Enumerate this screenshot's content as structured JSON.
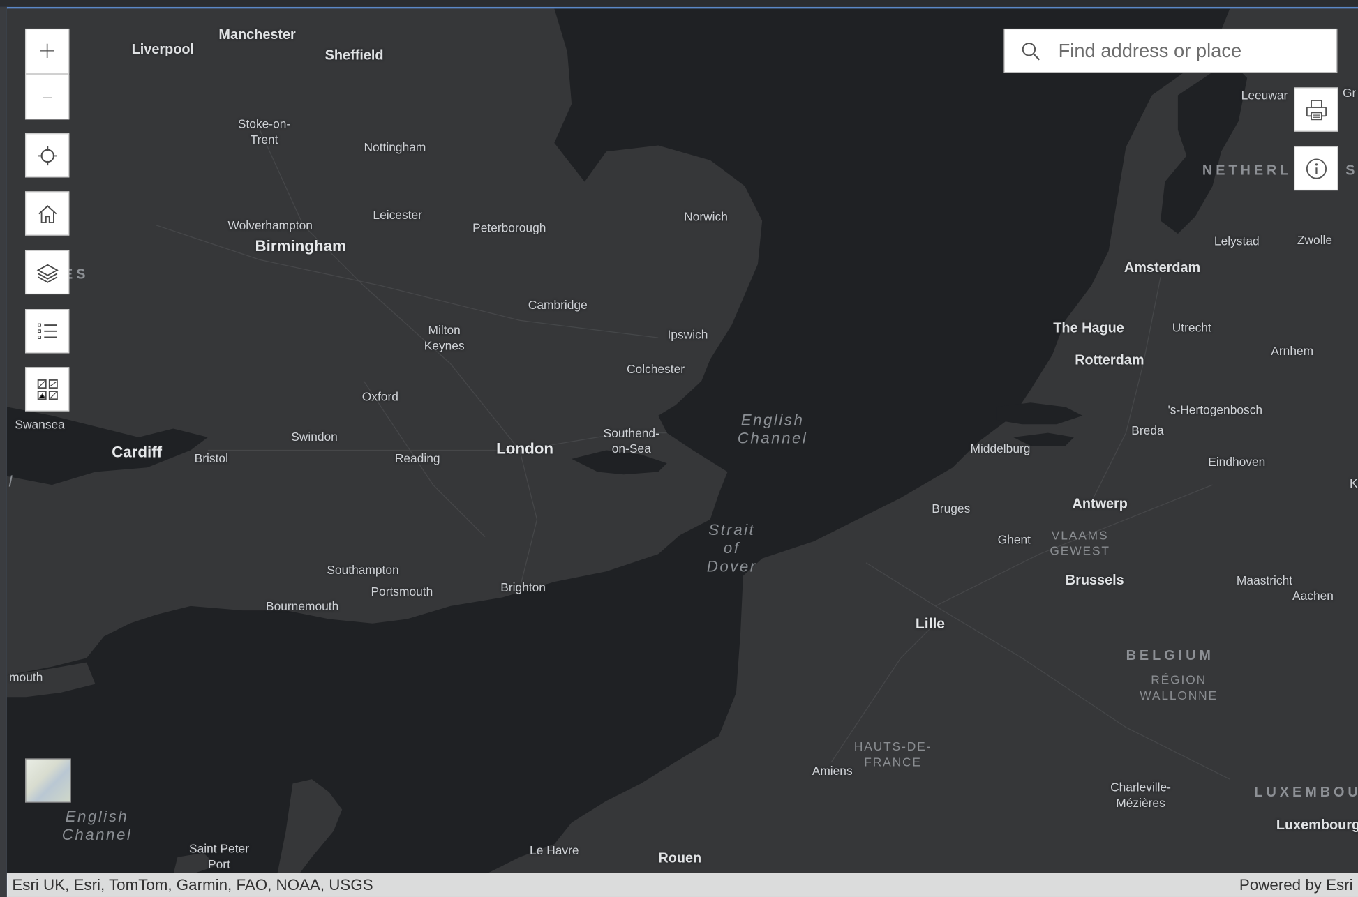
{
  "search": {
    "placeholder": "Find address or place"
  },
  "attribution": {
    "sources": "Esri UK, Esri, TomTom, Garmin, FAO, NOAA, USGS",
    "powered_by": "Powered by Esri"
  },
  "controls": {
    "zoom_in": "+",
    "zoom_out": "–"
  },
  "labels": {
    "cities_major": [
      "London",
      "Birmingham",
      "Cardiff",
      "Amsterdam",
      "The Hague",
      "Rotterdam",
      "Antwerp",
      "Brussels",
      "Lille",
      "Rouen",
      "Luxembourg",
      "Liverpool",
      "Manchester",
      "Sheffield"
    ],
    "cities": [
      "Stoke-on-Trent",
      "Nottingham",
      "Wolverhampton",
      "Leicester",
      "Peterborough",
      "Norwich",
      "Cambridge",
      "Milton Keynes",
      "Ipswich",
      "Colchester",
      "Oxford",
      "Swindon",
      "Bristol",
      "Reading",
      "Southend-on-Sea",
      "Southampton",
      "Portsmouth",
      "Brighton",
      "Bournemouth",
      "Swansea",
      "Saint Peter Port",
      "Le Havre",
      "Amiens",
      "Charleville-Mézières",
      "Bruges",
      "Ghent",
      "Middelburg",
      "Breda",
      "Eindhoven",
      "'s-Hertogenbosch",
      "Utrecht",
      "Arnhem",
      "Maastricht",
      "Aachen",
      "Lelystad",
      "Zwolle",
      "Leeuwarden",
      "mouth",
      "Gr",
      "K"
    ],
    "Liverpool": "Liverpool",
    "Manchester": "Manchester",
    "Sheffield": "Sheffield",
    "Stoke": "Stoke-on-\nTrent",
    "Nottingham": "Nottingham",
    "Wolverhampton": "Wolverhampton",
    "Leicester": "Leicester",
    "Peterborough": "Peterborough",
    "Norwich": "Norwich",
    "Birmingham": "Birmingham",
    "Cambridge": "Cambridge",
    "Milton": "Milton\nKeynes",
    "Ipswich": "Ipswich",
    "Colchester": "Colchester",
    "Oxford": "Oxford",
    "Swansea": "Swansea",
    "Swindon": "Swindon",
    "Cardiff": "Cardiff",
    "Bristol": "Bristol",
    "Reading": "Reading",
    "London": "London",
    "Southend": "Southend-\non-Sea",
    "Southampton": "Southampton",
    "Portsmouth": "Portsmouth",
    "Brighton": "Brighton",
    "Bournemouth": "Bournemouth",
    "mouth": "mouth",
    "SaintPeter": "Saint Peter\nPort",
    "LeHavre": "Le Havre",
    "Rouen": "Rouen",
    "Amiens": "Amiens",
    "Charleville": "Charleville-\nMézières",
    "Luxembourg": "Luxembourg",
    "Lille": "Lille",
    "Brussels": "Brussels",
    "Ghent": "Ghent",
    "Bruges": "Bruges",
    "Antwerp": "Antwerp",
    "Middelburg": "Middelburg",
    "Breda": "Breda",
    "Eindhoven": "Eindhoven",
    "Hertogenbosch": "'s-Hertogenbosch",
    "Rotterdam": "Rotterdam",
    "TheHague": "The Hague",
    "Utrecht": "Utrecht",
    "Arnhem": "Arnhem",
    "Amsterdam": "Amsterdam",
    "Lelystad": "Lelystad",
    "Zwolle": "Zwolle",
    "Leeuwarden": "Leeuwar",
    "Gr": "Gr",
    "Maastricht": "Maastricht",
    "Aachen": "Aachen",
    "K": "K"
  },
  "countries": {
    "Netherlands": "NETHERL",
    "NetherlandsTail": "S",
    "Belgium": "BELGIUM",
    "Luxembourg": "LUXEMBOU",
    "Wales": "ES"
  },
  "regions": {
    "Vlaams": "VLAAMS\nGEWEST",
    "Wallonne": "RÉGION\nWALLONNE",
    "HautsDeFrance": "HAUTS-DE-\nFRANCE"
  },
  "water": {
    "EnglishChannelEast": "English\nChannel",
    "StraitOfDover": "Strait\nof\nDover",
    "EnglishChannelWest": "English\nChannel",
    "BristolChannelFragment": "l"
  },
  "colors": {
    "land": "#363739",
    "water": "#1f2124",
    "ui_border": "#5b88c8"
  }
}
